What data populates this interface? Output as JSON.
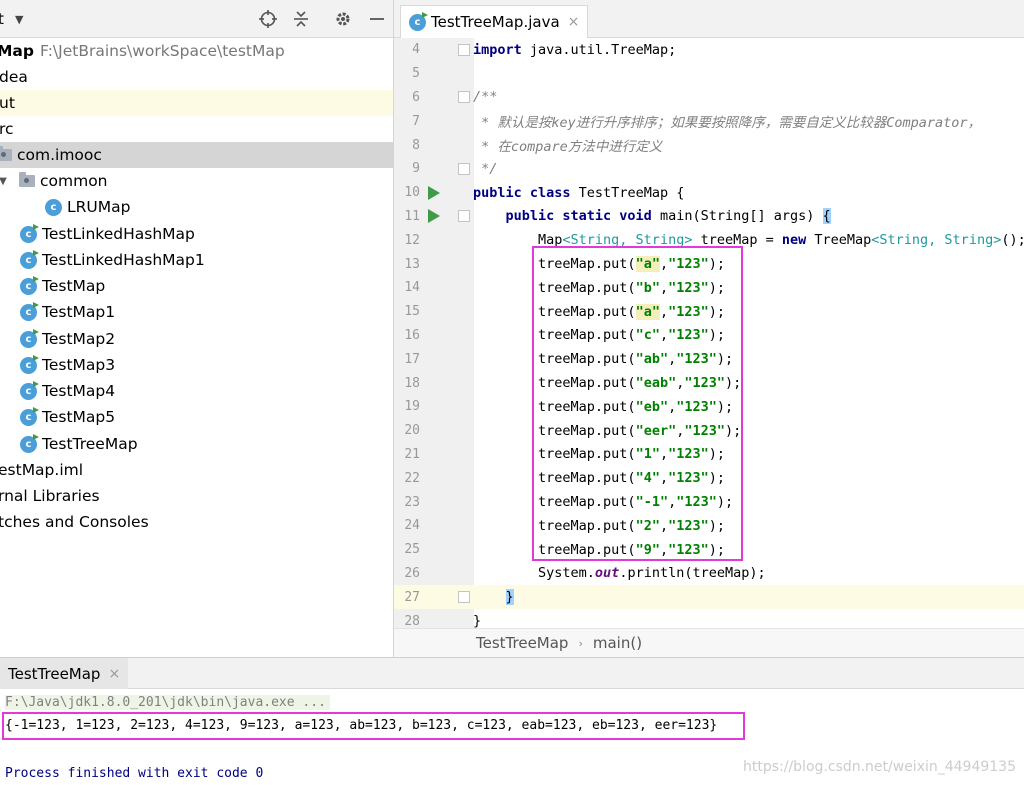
{
  "project_panel": {
    "title": "t",
    "rows": [
      {
        "label": "Map",
        "path": "F:\\JetBrains\\workSpace\\testMap"
      },
      {
        "label": "dea"
      },
      {
        "label": "ut"
      },
      {
        "label": "rc"
      },
      {
        "label": "com.imooc"
      },
      {
        "label": "common"
      },
      {
        "label": "LRUMap"
      },
      {
        "label": "TestLinkedHashMap"
      },
      {
        "label": "TestLinkedHashMap1"
      },
      {
        "label": "TestMap"
      },
      {
        "label": "TestMap1"
      },
      {
        "label": "TestMap2"
      },
      {
        "label": "TestMap3"
      },
      {
        "label": "TestMap4"
      },
      {
        "label": "TestMap5"
      },
      {
        "label": "TestTreeMap"
      },
      {
        "label": "estMap.iml"
      },
      {
        "label": "rnal Libraries"
      },
      {
        "label": "tches and Consoles"
      }
    ]
  },
  "editor": {
    "tab_label": "TestTreeMap.java",
    "tab_close": "×",
    "lines": [
      {
        "num": "4",
        "text": "import java.util.TreeMap;"
      },
      {
        "num": "5",
        "text": ""
      },
      {
        "num": "6",
        "text": "/**"
      },
      {
        "num": "7",
        "text": " * 默认是按key进行升序排序；如果要按照降序，需要自定义比较器Comparator，"
      },
      {
        "num": "8",
        "text": " * 在compare方法中进行定义"
      },
      {
        "num": "9",
        "text": " */"
      },
      {
        "num": "10",
        "text": "public class TestTreeMap {"
      },
      {
        "num": "11",
        "text": "    public static void main(String[] args) {"
      },
      {
        "num": "12",
        "text": "        Map<String, String> treeMap = new TreeMap<String, String>();"
      },
      {
        "num": "13",
        "text": "        treeMap.put(\"a\",\"123\");"
      },
      {
        "num": "14",
        "text": "        treeMap.put(\"b\",\"123\");"
      },
      {
        "num": "15",
        "text": "        treeMap.put(\"a\",\"123\");"
      },
      {
        "num": "16",
        "text": "        treeMap.put(\"c\",\"123\");"
      },
      {
        "num": "17",
        "text": "        treeMap.put(\"ab\",\"123\");"
      },
      {
        "num": "18",
        "text": "        treeMap.put(\"eab\",\"123\");"
      },
      {
        "num": "19",
        "text": "        treeMap.put(\"eb\",\"123\");"
      },
      {
        "num": "20",
        "text": "        treeMap.put(\"eer\",\"123\");"
      },
      {
        "num": "21",
        "text": "        treeMap.put(\"1\",\"123\");"
      },
      {
        "num": "22",
        "text": "        treeMap.put(\"4\",\"123\");"
      },
      {
        "num": "23",
        "text": "        treeMap.put(\"-1\",\"123\");"
      },
      {
        "num": "24",
        "text": "        treeMap.put(\"2\",\"123\");"
      },
      {
        "num": "25",
        "text": "        treeMap.put(\"9\",\"123\");"
      },
      {
        "num": "26",
        "text": "        System.out.println(treeMap);"
      },
      {
        "num": "27",
        "text": "    }"
      },
      {
        "num": "28",
        "text": "}"
      }
    ],
    "current_line": "27",
    "breadcrumb": [
      "TestTreeMap",
      "main()"
    ]
  },
  "run_panel": {
    "tab_label": "TestTreeMap",
    "tab_close": "×",
    "command": "F:\\Java\\jdk1.8.0_201\\jdk\\bin\\java.exe ...",
    "output": "{-1=123, 1=123, 2=123, 4=123, 9=123, a=123, ab=123, b=123, c=123, eab=123, eb=123, eer=123}",
    "exit_message": "Process finished with exit code 0",
    "watermark": "https://blog.csdn.net/weixin_44949135"
  },
  "colors": {
    "highlight_box": "#e23ad8",
    "run_icon": "#3f9b45",
    "class_icon": "#4a9fd8",
    "keyword": "#000080",
    "string": "#008000"
  }
}
